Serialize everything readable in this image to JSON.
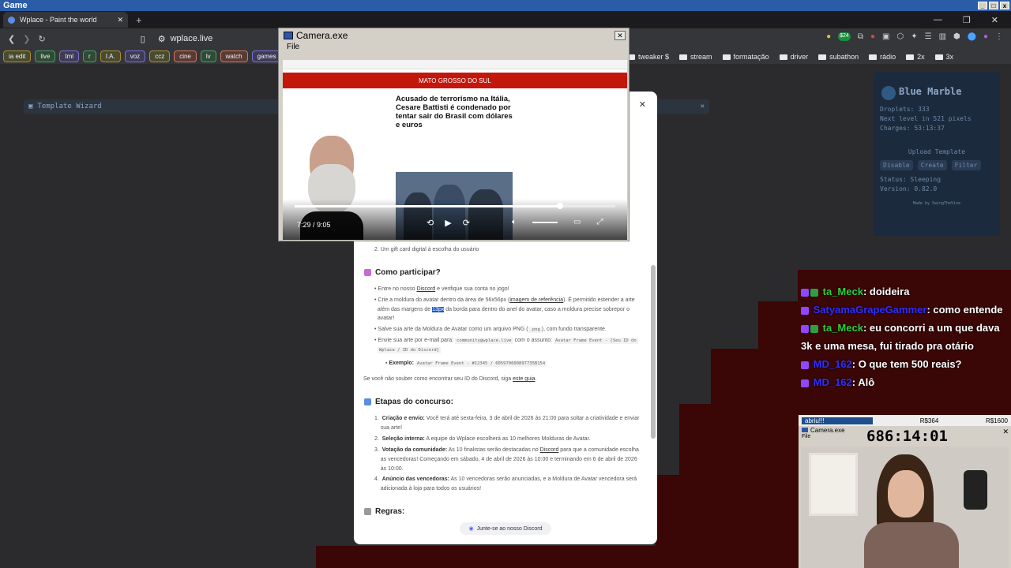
{
  "os_title": "Game",
  "browser": {
    "tab_title": "Wplace - Paint the world",
    "tab_close": "✕",
    "new_tab": "+",
    "url": "wplace.live",
    "bookmarks": [
      "ia edit",
      "live",
      "tml",
      "r",
      "I.A.",
      "voz",
      "ccz",
      "cine",
      "lv",
      "watch",
      "games"
    ],
    "bookmark_folders": [
      "tweaker $",
      "stream",
      "formatação",
      "driver",
      "subathon",
      "rádio",
      "2x",
      "3x"
    ],
    "ext_badge": "$24"
  },
  "wizard": {
    "title": "Template Wizard",
    "close": "✕"
  },
  "blue_marble": {
    "title": "Blue Marble",
    "droplets": "Droplets: 333",
    "next_level": "Next level in 521 pixels",
    "charges": "Charges: 53:13:37",
    "upload": "Upload Template",
    "buttons": [
      "Disable",
      "Create",
      "Filter"
    ],
    "status": "Status: Sleeping",
    "version": "Version: 0.82.0",
    "footer": "Made by SwingTheVine"
  },
  "camera": {
    "title": "Camera.exe",
    "menu": "File",
    "close": "✕",
    "video": {
      "site": "MATO GROSSO DO SUL",
      "headline": "Acusado de terrorismo na Itália, Cesare Battisti é condenado por tentar sair do Brasil com dólares e euros",
      "time": "7:29 / 9:05",
      "progress": 0.827
    }
  },
  "modal": {
    "close": "✕",
    "prize2": "2.   Um gift card digital à escolha do usuário",
    "how_title": "Como participar?",
    "how_1a": "Entre no nosso ",
    "how_1_link": "Discord",
    "how_1b": " e verifique sua conta no jogo!",
    "how_2a": "Crie a moldura do avatar dentro da área de 56x56px (",
    "how_2_link": "imagem de referência",
    "how_2b": "). É permitido estender a arte",
    "how_2c": "além das margens de ",
    "how_2_hl": "13px",
    "how_2d": " da borda para dentro do anel do avatar, caso a moldura precise sobrepor o",
    "how_2e": "avatar!",
    "how_3a": "Salve sua arte da Moldura de Avatar como um arquivo PNG (",
    "how_3_code": ".png",
    "how_3b": "), com fundo transparente.",
    "how_4a": "Envie sua arte por e-mail para: ",
    "how_4_code": "community@wplace.live",
    "how_4b": " com o assunto: ",
    "how_4_code2": "Avatar Frame Event - [Seu ID do",
    "how_4_code3": "Wplace / ID do Discord]",
    "example_label": "Exemplo:",
    "example_code": "Avatar Frame Event - #12345 / 605970600897735B154",
    "discord_note_a": "Se você não souber como encontrar seu ID do Discord, siga ",
    "discord_note_link": "este guia",
    "stages_title": "Etapas do concurso:",
    "stage1_b": "Criação e envio:",
    "stage1": " Você terá até sexta-feira, 3 de abril de 2026 às 21:00 para soltar a criatividade e enviar",
    "stage1c": "sua arte!",
    "stage2_b": "Seleção interna:",
    "stage2": " A equipe do Wplace escolherá as 10 melhores Molduras de Avatar.",
    "stage3_b": "Votação da comunidade:",
    "stage3": " As 10 finalistas serão destacadas no ",
    "stage3_link": "Discord",
    "stage3b": " para que a comunidade escolha",
    "stage3c": "as vencedoras! Começando em sábado, 4 de abril de 2026 às 10:00 e terminando em 6 de abril de 2026",
    "stage3d": "às 10:00.",
    "stage4_b": "Anúncio das vencedoras:",
    "stage4": " As 10 vencedoras serão anunciadas, e a Moldura de Avatar vencedora será",
    "stage4c": "adicionada à loja para todos os usuários!",
    "rules_title": "Regras:",
    "discord_button": "Junte-se ao nosso Discord"
  },
  "chat": [
    {
      "user": "ta_Meck",
      "color": "#2ecc40",
      "text": ": doideira"
    },
    {
      "user": "SatyamaGrapeGammer",
      "color": "#2f2fff",
      "text": ": como entende"
    },
    {
      "user": "ta_Meck",
      "color": "#2ecc40",
      "text": ": eu concorri a um que dava 3k e uma mesa, fui tirado pra otário"
    },
    {
      "user": "MD_162",
      "color": "#2f2fff",
      "text": ": O que tem 500 reais?"
    },
    {
      "user": "MD_162",
      "color": "#2f2fff",
      "text": ": Alô"
    }
  ],
  "cam2": {
    "label": "abriu!!!",
    "amount1": "R$364",
    "amount2": "R$1600",
    "title": "Camera.exe",
    "timer": "686:14:01",
    "file": "File",
    "close": "✕"
  }
}
